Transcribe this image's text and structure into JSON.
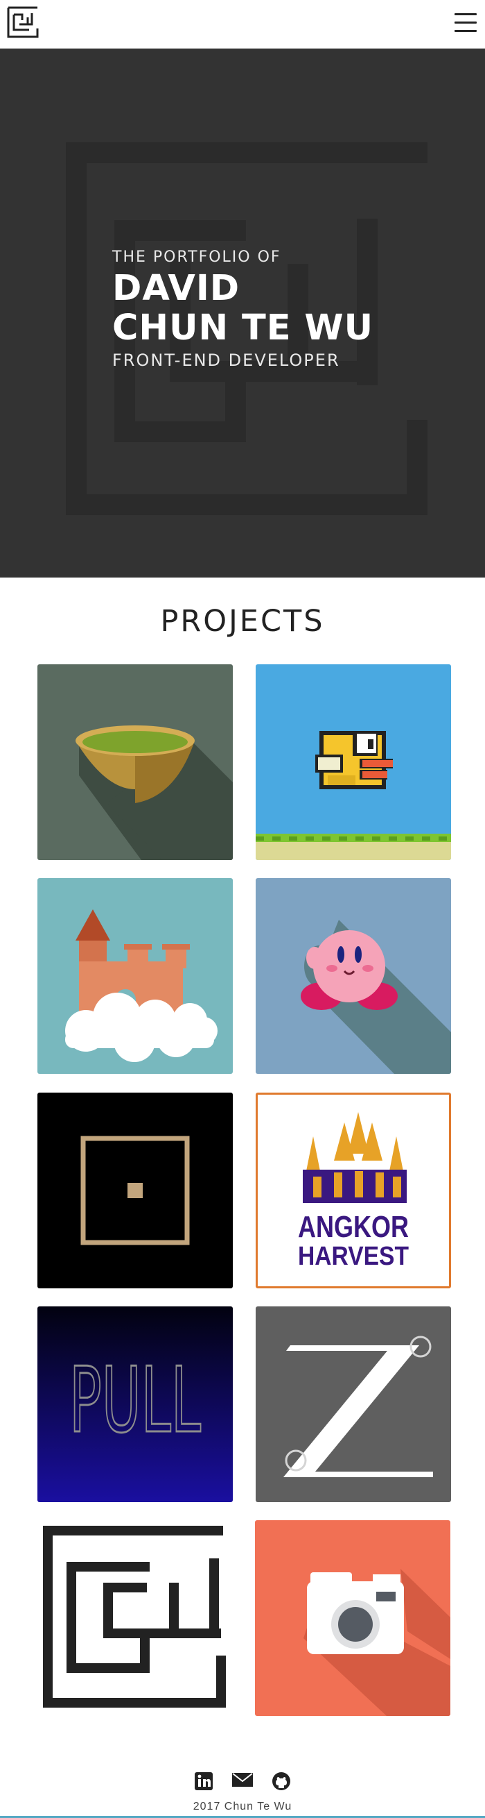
{
  "header": {
    "logo_icon": "cw-maze-logo-icon",
    "menu_icon": "hamburger-menu-icon"
  },
  "hero": {
    "pre": "THE PORTFOLIO OF",
    "name_line1": "DAVID",
    "name_line2": "CHUN TE WU",
    "role": "FRONT-END DEVELOPER",
    "background": "#333333"
  },
  "projects": {
    "title": "PROJECTS",
    "tiles": [
      {
        "icon": "tea-bowl-icon",
        "bg": "#5a6b60"
      },
      {
        "icon": "flappy-bird-icon",
        "bg": "#4aa9e1"
      },
      {
        "icon": "castle-cloud-icon",
        "bg": "#78b8be"
      },
      {
        "icon": "kirby-icon",
        "bg": "#7ea3c2"
      },
      {
        "icon": "square-dot-icon",
        "bg": "#000000"
      },
      {
        "icon": "angkor-harvest-logo",
        "bg": "#ffffff",
        "text1": "ANGKOR",
        "text2": "HARVEST"
      },
      {
        "icon": "pull-game-icon",
        "bg": "#0b0b4a",
        "text": "PULL"
      },
      {
        "icon": "z-letter-icon",
        "bg": "#5f5f5f"
      },
      {
        "icon": "cw-maze-icon",
        "bg": "#ffffff"
      },
      {
        "icon": "camera-icon",
        "bg": "#f17054"
      }
    ]
  },
  "footer": {
    "icons": [
      "linkedin-icon",
      "email-icon",
      "github-icon"
    ],
    "copyright": "2017 Chun Te Wu"
  }
}
